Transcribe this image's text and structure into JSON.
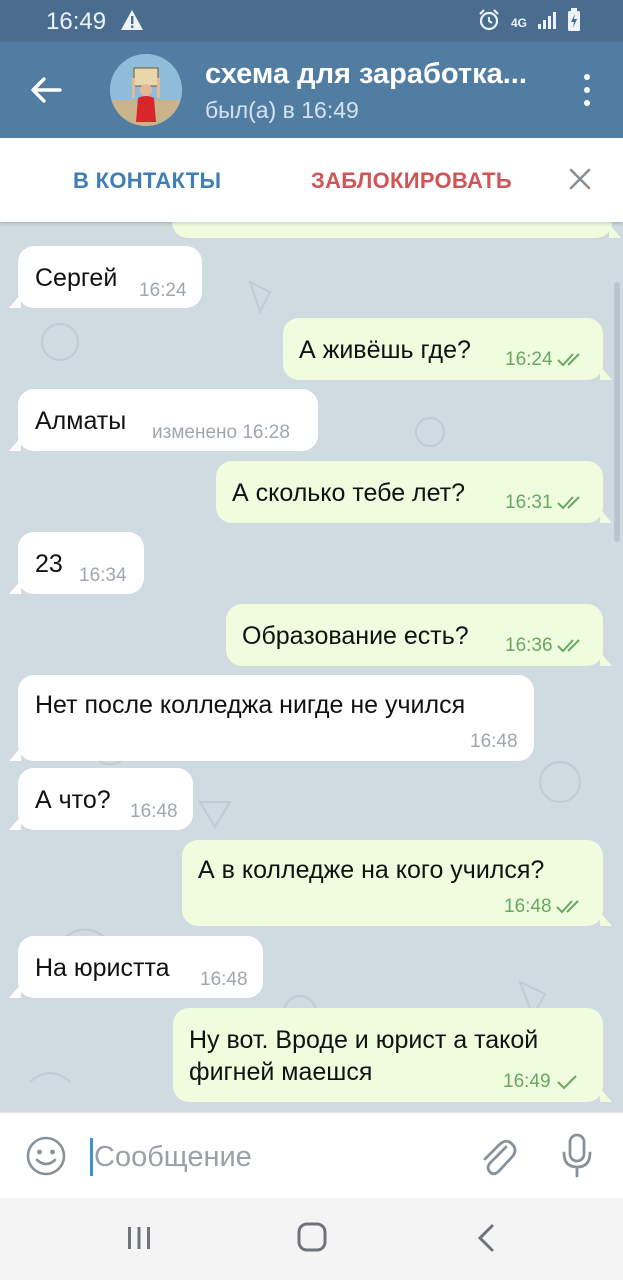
{
  "status_bar": {
    "time": "16:49",
    "network": "4G"
  },
  "header": {
    "title": "схема для заработка...",
    "subtitle": "был(а) в 16:49"
  },
  "action_bar": {
    "add_contact": "В КОНТАКТЫ",
    "block": "ЗАБЛОКИРОВАТЬ"
  },
  "messages": [
    {
      "dir": "in",
      "text": "Сергей",
      "time": "16:24"
    },
    {
      "dir": "out",
      "text": "А живёшь где?",
      "time": "16:24",
      "read": true
    },
    {
      "dir": "in",
      "text": "Алматы",
      "time": "изменено 16:28"
    },
    {
      "dir": "out",
      "text": "А сколько тебе лет?",
      "time": "16:31",
      "read": true
    },
    {
      "dir": "in",
      "text": "23",
      "time": "16:34"
    },
    {
      "dir": "out",
      "text": "Образование есть?",
      "time": "16:36",
      "read": true
    },
    {
      "dir": "in",
      "text": "Нет после колледжа нигде не учился",
      "time": "16:48"
    },
    {
      "dir": "in",
      "text": "А что?",
      "time": "16:48"
    },
    {
      "dir": "out",
      "text": "А в колледже на кого учился?",
      "time": "16:48",
      "read": true
    },
    {
      "dir": "in",
      "text": "На юристта",
      "time": "16:48"
    },
    {
      "dir": "out",
      "text_line1": "Ну вот. Вроде и юрист а такой",
      "text_line2": "фигней маешся",
      "time": "16:49",
      "read": false
    }
  ],
  "composer": {
    "placeholder": "Сообщение"
  },
  "colors": {
    "header": "#527da3",
    "status_bar": "#4a6d8f",
    "outgoing_bubble": "#effdde",
    "incoming_bubble": "#ffffff",
    "check": "#68a862",
    "block_red": "#cf5656",
    "add_blue": "#3f7fb5"
  },
  "icons": [
    "warning-icon",
    "alarm-icon",
    "signal-icon",
    "battery-icon",
    "back-arrow-icon",
    "more-vert-icon",
    "close-icon",
    "double-check-icon",
    "single-check-icon",
    "emoji-icon",
    "attach-icon",
    "mic-icon",
    "nav-recent-icon",
    "nav-home-icon",
    "nav-back-icon"
  ]
}
